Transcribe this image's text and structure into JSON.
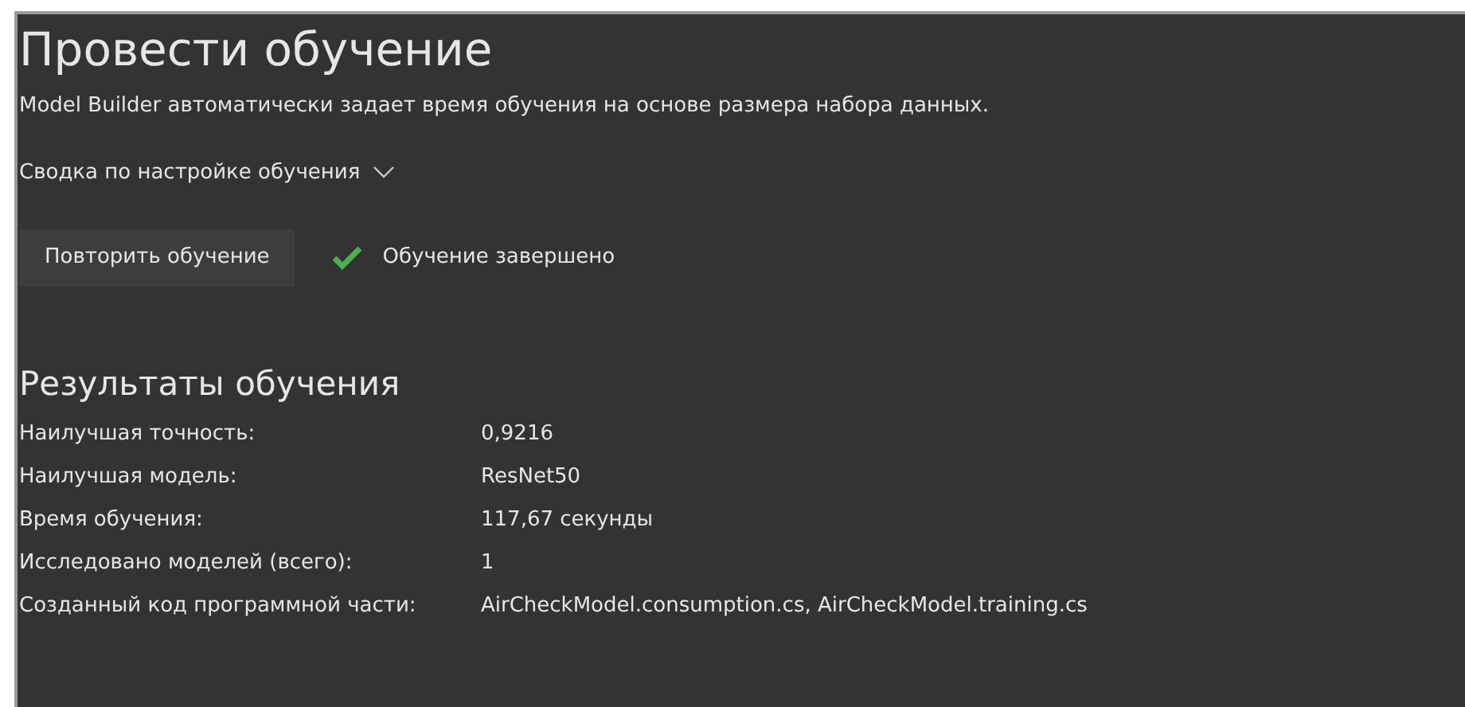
{
  "title": "Провести обучение",
  "description": "Model Builder автоматически задает время обучения на основе размера набора данных.",
  "summary": {
    "label": "Сводка по настройке обучения",
    "expanded": false
  },
  "retrain_button": "Повторить обучение",
  "status": {
    "kind": "success",
    "text": "Обучение завершено"
  },
  "results": {
    "heading": "Результаты обучения",
    "rows": [
      {
        "label": "Наилучшая точность:",
        "value": "0,9216"
      },
      {
        "label": "Наилучшая модель:",
        "value": "ResNet50"
      },
      {
        "label": "Время обучения:",
        "value": "117,67 секунды"
      },
      {
        "label": "Исследовано моделей (всего):",
        "value": "1"
      },
      {
        "label": "Созданный код программной части:",
        "value": "AirCheckModel.consumption.cs, AirCheckModel.training.cs"
      }
    ]
  }
}
